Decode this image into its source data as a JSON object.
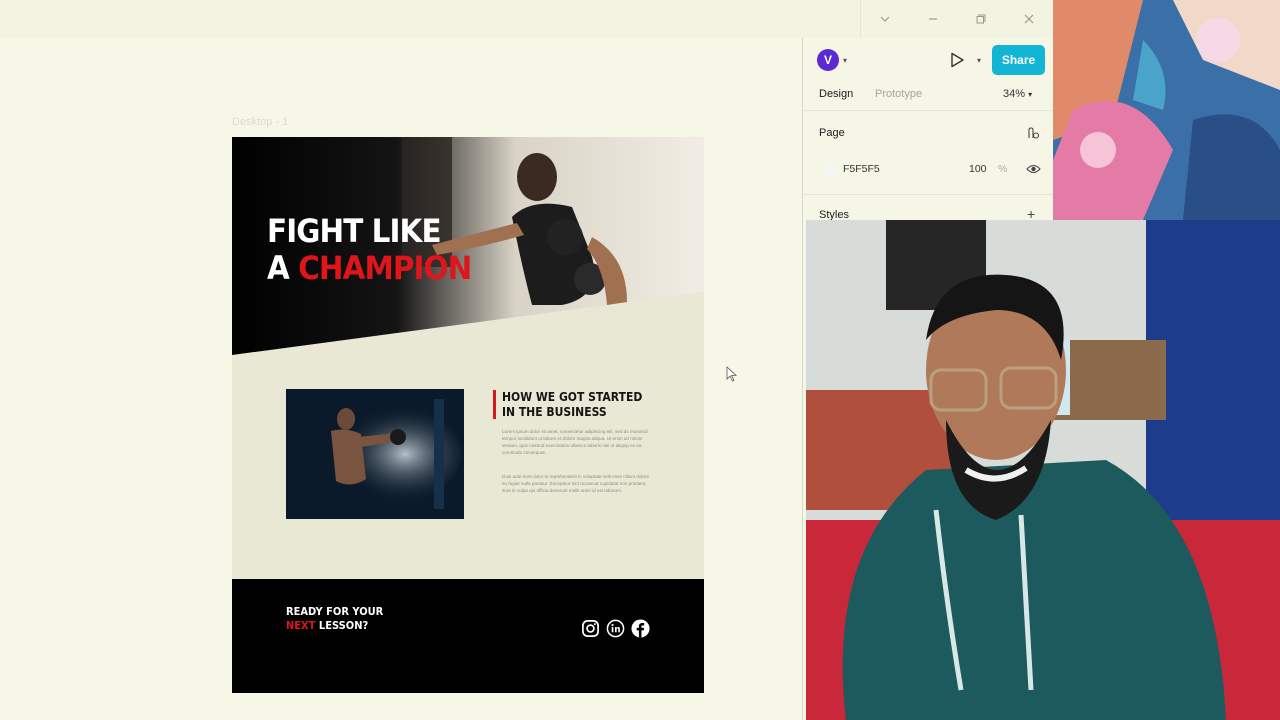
{
  "canvas": {
    "frame_label": "Desktop - 1",
    "hero": {
      "line1": "FIGHT LIKE",
      "line2_white": "A ",
      "line2_red": "CHAMPION"
    },
    "about": {
      "title_line1": "HOW WE GOT STARTED",
      "title_line2": "IN THE BUSINESS",
      "paragraph1": "Lorem ipsum dolor sit amet, consectetur adipiscing elit, sed do eiusmod tempor incididunt ut labore et dolore magna aliqua. Ut enim ad minim veniam, quis nostrud exercitation ullamco laboris nisi ut aliquip ex ea commodo consequat.",
      "paragraph2": "Duis aute irure dolor in reprehenderit in voluptate velit esse cillum dolore eu fugiat nulla pariatur. Excepteur sint occaecat cupidatat non proident, sunt in culpa qui officia deserunt mollit anim id est laborum."
    },
    "footer": {
      "cta_line1": "READY FOR YOUR",
      "cta_red": "NEXT",
      "cta_rest": " LESSON?"
    }
  },
  "panel": {
    "avatar_initial": "V",
    "share_label": "Share",
    "tabs": [
      "Design",
      "Prototype"
    ],
    "zoom": "34%",
    "page_label": "Page",
    "fill_hex": "F5F5F5",
    "fill_opacity": "100",
    "opacity_unit": "%",
    "styles_label": "Styles"
  },
  "colors": {
    "accent_red": "#e0151b",
    "share_button": "#13b4d4",
    "avatar": "#5a2ad1"
  },
  "icons": [
    "chevron-down-icon",
    "minimize-icon",
    "restore-icon",
    "close-icon",
    "play-icon",
    "component-icon",
    "eye-icon",
    "plus-icon",
    "instagram-icon",
    "linkedin-icon",
    "facebook-icon"
  ]
}
